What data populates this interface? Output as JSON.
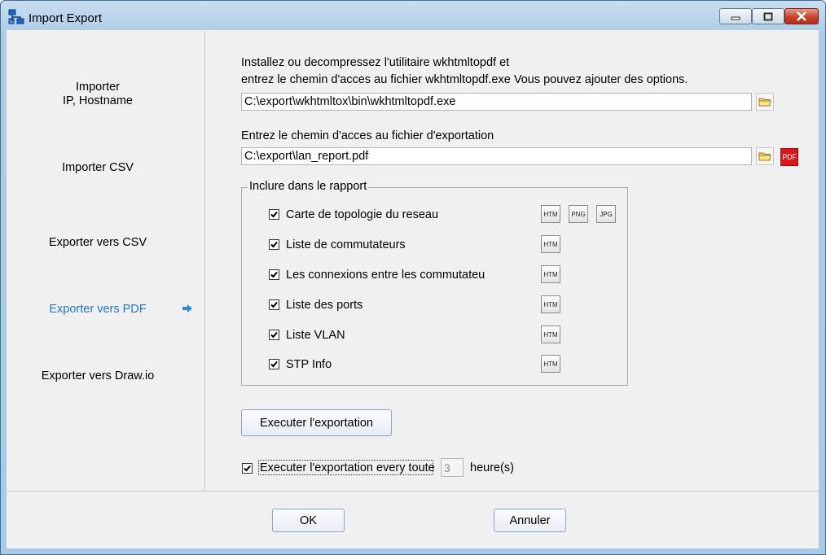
{
  "window": {
    "title": "Import Export",
    "controls": {
      "minimize": "minimize-icon",
      "maximize": "maximize-icon",
      "close": "close-icon"
    }
  },
  "sidebar": {
    "items": [
      {
        "line1": "Importer",
        "line2": "IP, Hostname"
      },
      {
        "line1": "Importer CSV"
      },
      {
        "line1": "Exporter vers CSV"
      },
      {
        "line1": "Exporter vers PDF",
        "active": true
      },
      {
        "line1": "Exporter vers Draw.io"
      }
    ],
    "active_color": "#1e78c8"
  },
  "main": {
    "instructions_line1": "Installez ou decompressez l'utilitaire wkhtmltopdf et",
    "instructions_line2": "entrez le chemin d'acces au fichier wkhtmltopdf.exe  Vous pouvez ajouter des options.",
    "tool_path": "C:\\export\\wkhtmltox\\bin\\wkhtmltopdf.exe",
    "export_label": "Entrez le chemin d'acces au fichier d'exportation",
    "export_path": "C:\\export\\lan_report.pdf",
    "pdf_icon_label": "PDF",
    "report_group": {
      "label": "Inclure dans le rapport",
      "items": [
        {
          "label": "Carte de topologie du reseau",
          "checked": true,
          "formats": [
            "HTM",
            "PNG",
            "JPG"
          ]
        },
        {
          "label": "Liste de commutateurs",
          "checked": true,
          "formats": [
            "HTM"
          ]
        },
        {
          "label": "Les connexions entre les commutateu",
          "checked": true,
          "formats": [
            "HTM"
          ]
        },
        {
          "label": "Liste des ports",
          "checked": true,
          "formats": [
            "HTM"
          ]
        },
        {
          "label": "Liste VLAN",
          "checked": true,
          "formats": [
            "HTM"
          ]
        },
        {
          "label": "STP Info",
          "checked": true,
          "formats": [
            "HTM"
          ]
        }
      ]
    },
    "execute_button": "Executer l'exportation",
    "schedule": {
      "checked": true,
      "label": "Executer l'exportation every toute",
      "hours": "3",
      "unit": "heure(s)"
    }
  },
  "footer": {
    "ok": "OK",
    "cancel": "Annuler"
  }
}
